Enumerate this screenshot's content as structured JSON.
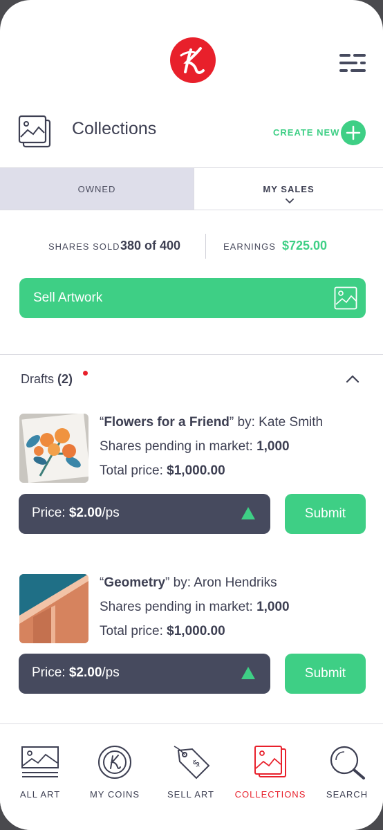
{
  "header": {
    "logo_icon": "k-logo-icon",
    "menu_icon": "menu-icon"
  },
  "title_row": {
    "title": "Collections",
    "create_new": "CREATE NEW",
    "icon": "collections-icon"
  },
  "tabs": [
    {
      "label": "OWNED",
      "active": false
    },
    {
      "label": "MY SALES",
      "active": true
    }
  ],
  "stats": {
    "shares_sold_label": "SHARES SOLD",
    "shares_sold_value": "380 of 400",
    "earnings_label": "EARNINGS",
    "earnings_value": "$725.00"
  },
  "sell_artwork": {
    "label": "Sell Artwork",
    "icon": "image-icon"
  },
  "drafts": {
    "title": "Drafts",
    "count": "(2)",
    "items": [
      {
        "open_quote": "“",
        "name": "Flowers for a Friend",
        "by": "” by: Kate Smith",
        "shares_label": "Shares pending in market: ",
        "shares_value": "1,000",
        "total_label": "Total price: ",
        "total_value": "$1,000.00",
        "price_label": "Price: ",
        "price_value": "$2.00",
        "price_unit": "/ps",
        "submit": "Submit"
      },
      {
        "open_quote": "“",
        "name": "Geometry",
        "by": "” by: Aron Hendriks",
        "shares_label": "Shares pending in market: ",
        "shares_value": "1,000",
        "total_label": "Total price: ",
        "total_value": "$1,000.00",
        "price_label": "Price: ",
        "price_value": "$2.00",
        "price_unit": "/ps",
        "submit": "Submit"
      }
    ]
  },
  "bottom_nav": [
    {
      "label": "ALL ART",
      "icon": "all-art-icon",
      "active": false
    },
    {
      "label": "MY COINS",
      "icon": "coin-icon",
      "active": false
    },
    {
      "label": "SELL ART",
      "icon": "price-tag-icon",
      "active": false
    },
    {
      "label": "COLLECTIONS",
      "icon": "collections-icon",
      "active": true
    },
    {
      "label": "SEARCH",
      "icon": "search-icon",
      "active": false
    }
  ],
  "colors": {
    "accent_green": "#3ecf85",
    "brand_red": "#e8202b",
    "dark": "#464a5e"
  }
}
